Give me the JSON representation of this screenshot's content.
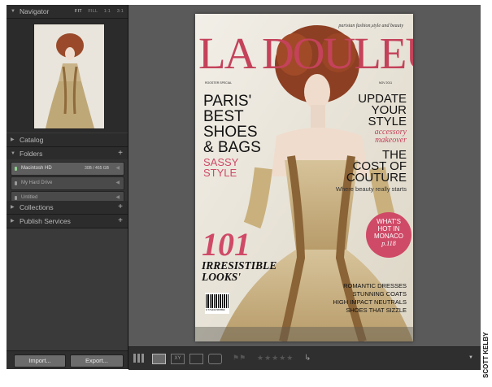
{
  "navigator": {
    "title": "Navigator",
    "zoom_options": [
      "FIT",
      "FILL",
      "1:1",
      "3:1"
    ]
  },
  "panels": {
    "catalog": "Catalog",
    "folders": "Folders",
    "collections": "Collections",
    "publish_services": "Publish Services"
  },
  "folders_list": [
    {
      "name": "Macintosh HD",
      "size": "30B / 465 GB",
      "selected": true
    },
    {
      "name": "My Hard Drive",
      "size": "",
      "selected": false
    },
    {
      "name": "Untitled",
      "size": "",
      "selected": false
    }
  ],
  "buttons": {
    "import": "Import...",
    "export": "Export..."
  },
  "cover": {
    "masthead": "LA DOULEUR",
    "tagline": "parisian fashion,style and beauty",
    "issue_left": "ROOSTER SPECIAL",
    "issue_right": "NOV 2011",
    "headline_left": [
      "PARIS'",
      "BEST",
      "SHOES",
      "& BAGS"
    ],
    "sassy": [
      "SASSY",
      "STYLE"
    ],
    "update": [
      "UPDATE",
      "YOUR",
      "STYLE"
    ],
    "accessory": [
      "accessory",
      "makeover"
    ],
    "cost": [
      "THE",
      "COST OF",
      "COUTURE"
    ],
    "where": "Where beauty really starts",
    "circle": [
      "WHAT'S",
      "HOT IN",
      "MONACO",
      "p.118"
    ],
    "big_number": "101",
    "irresistible": [
      "IRRESISTIBLE",
      "LOOKS'"
    ],
    "right_list": [
      "ROMANTIC DRESSES",
      "STUNNING COATS",
      "HIGH IMPACT NEUTRALS",
      "SHOES THAT SIZZLE"
    ],
    "barcode_digits": "9 771234 567890"
  },
  "credit": "SCOTT KELBY",
  "colors": {
    "masthead": "#c4425a",
    "circle": "#cf4a67",
    "panel": "#3a3a3a",
    "canvas": "#5a5a5a"
  }
}
